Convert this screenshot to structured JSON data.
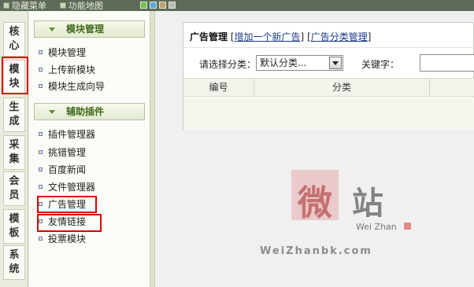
{
  "topbar": {
    "items": [
      {
        "label": "隐藏菜单",
        "icon": "hide-menu-icon"
      },
      {
        "label": "功能地图",
        "icon": "map-icon"
      }
    ],
    "swatch_colors": [
      "#6ec34a",
      "#58a6e0",
      "#c79e6e",
      "#b9b9b9"
    ]
  },
  "left_tabs": [
    {
      "label": "核心"
    },
    {
      "label": "模块",
      "active": true
    },
    {
      "label": "生成"
    },
    {
      "label": "采集"
    },
    {
      "label": "会员"
    },
    {
      "label": "模板"
    },
    {
      "label": "系统"
    }
  ],
  "sidebar": {
    "sections": [
      {
        "title": "模块管理",
        "items": [
          "模块管理",
          "上传新模块",
          "模块生成向导"
        ]
      },
      {
        "title": "辅助插件",
        "items": [
          "插件管理器",
          "挑错管理",
          "百度新闻",
          "文件管理器",
          "广告管理",
          "友情链接",
          "投票模块"
        ]
      }
    ]
  },
  "main": {
    "title": "广告管理",
    "links": {
      "add_ad": "增加一个新广告",
      "category_mgmt": "广告分类管理"
    },
    "filter_label": "请选择分类：",
    "category_select": "默认分类...",
    "keyword_label": "关键字：",
    "keyword_value": "",
    "table_headers": [
      "编号",
      "分类"
    ]
  },
  "watermark": {
    "glyph1": "微",
    "glyph2": "站",
    "sub": "Wei Zhan",
    "url": "WeiZhanbk.com"
  },
  "colors": {
    "highlight": "#e00000",
    "section_title": "#3f6a1c",
    "link": "#1a3a8a"
  }
}
